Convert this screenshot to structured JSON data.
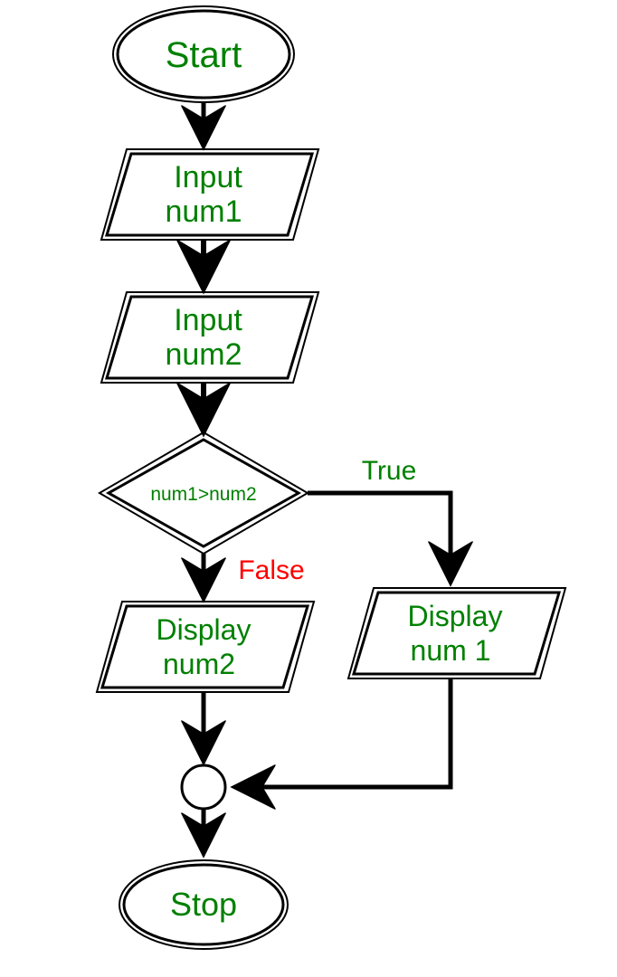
{
  "nodes": {
    "start": "Start",
    "input1_l1": "Input",
    "input1_l2": "num1",
    "input2_l1": "Input",
    "input2_l2": "num2",
    "decision": "num1>num2",
    "displayFalse_l1": "Display",
    "displayFalse_l2": "num2",
    "displayTrue_l1": "Display",
    "displayTrue_l2": "num 1",
    "stop": "Stop"
  },
  "edges": {
    "trueLabel": "True",
    "falseLabel": "False"
  }
}
